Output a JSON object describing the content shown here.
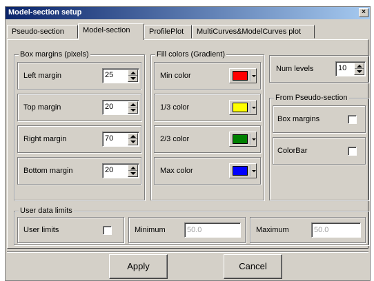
{
  "window": {
    "title": "Model-section setup",
    "close_label": "×"
  },
  "tabs": [
    "Pseudo-section",
    "Model-section",
    "ProfilePlot",
    "MultiCurves&ModelCurves plot"
  ],
  "box_margins": {
    "title": "Box margins (pixels)",
    "left": {
      "label": "Left margin",
      "value": "25"
    },
    "top": {
      "label": "Top margin",
      "value": "20"
    },
    "right": {
      "label": "Right margin",
      "value": "70"
    },
    "bottom": {
      "label": "Bottom margin",
      "value": "20"
    }
  },
  "fill_colors": {
    "title": "Fill colors (Gradient)",
    "min": {
      "label": "Min color",
      "color": "#ff0000"
    },
    "third1": {
      "label": "1/3 color",
      "color": "#ffff00"
    },
    "third2": {
      "label": "2/3 color",
      "color": "#008000"
    },
    "max": {
      "label": "Max color",
      "color": "#0000ff"
    }
  },
  "num_levels": {
    "label": "Num levels",
    "value": "10"
  },
  "pseudo": {
    "title": "From Pseudo-section",
    "box_margins_label": "Box margins",
    "colorbar_label": "ColorBar"
  },
  "user_limits": {
    "title": "User data limits",
    "user_limits_label": "User limits",
    "minimum_label": "Minimum",
    "minimum_value": "50.0",
    "maximum_label": "Maximum",
    "maximum_value": "50.0"
  },
  "buttons": {
    "apply": "Apply",
    "cancel": "Cancel"
  }
}
